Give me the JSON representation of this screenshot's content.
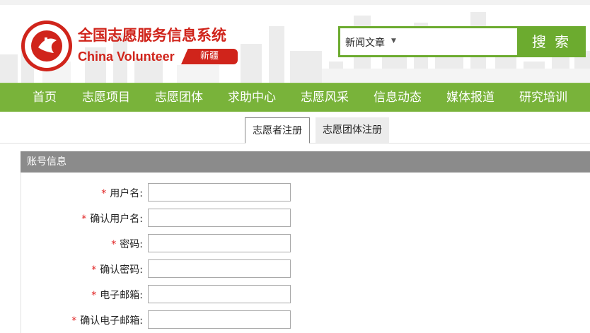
{
  "header": {
    "title_cn": "全国志愿服务信息系统",
    "title_en": "China Volunteer",
    "region": "新疆"
  },
  "search": {
    "type": "新闻文章",
    "value": "",
    "button": "搜 索"
  },
  "nav": {
    "items": [
      "首页",
      "志愿项目",
      "志愿团体",
      "求助中心",
      "志愿风采",
      "信息动态",
      "媒体报道",
      "研究培训"
    ]
  },
  "tabs": {
    "volunteer": "志愿者注册",
    "group": "志愿团体注册"
  },
  "section": {
    "title": "账号信息"
  },
  "form": {
    "required_mark": "*",
    "fields": [
      {
        "label": "用户名:",
        "value": ""
      },
      {
        "label": "确认用户名:",
        "value": ""
      },
      {
        "label": "密码:",
        "value": ""
      },
      {
        "label": "确认密码:",
        "value": ""
      },
      {
        "label": "电子邮箱:",
        "value": ""
      },
      {
        "label": "确认电子邮箱:",
        "value": ""
      }
    ]
  },
  "colors": {
    "brand_red": "#d0241b",
    "nav_green": "#79b33a",
    "search_green": "#6cab2f",
    "section_gray": "#8b8b8b"
  }
}
